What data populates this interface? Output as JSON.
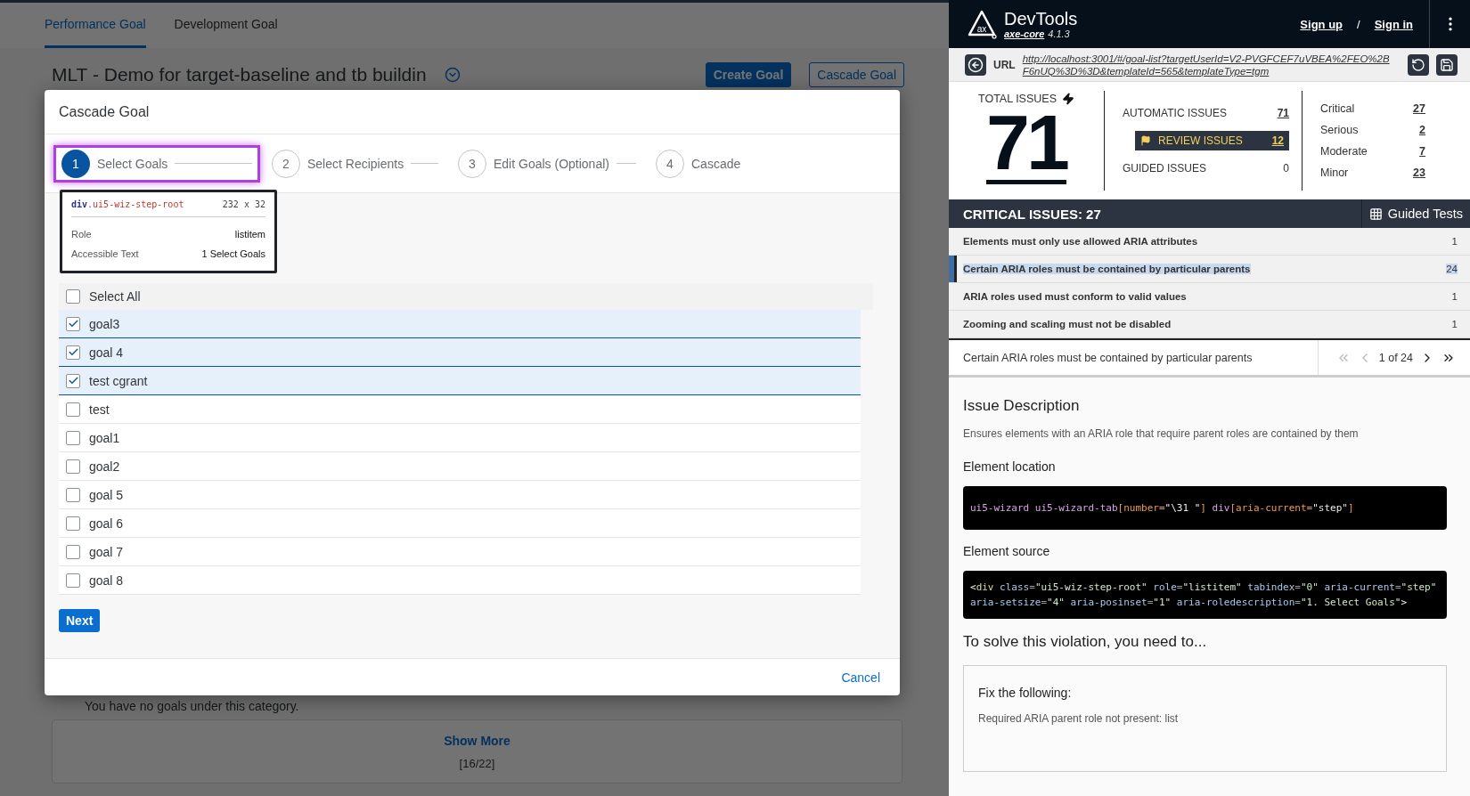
{
  "background_page": {
    "tabs": [
      {
        "label": "Performance Goal",
        "selected": true
      },
      {
        "label": "Development Goal",
        "selected": false
      }
    ],
    "title": "MLT - Demo for target-baseline and tb buildin",
    "buttons": [
      {
        "label": "Create Goal",
        "kind": "primary"
      },
      {
        "label": "Cascade Goal",
        "kind": "secondary"
      }
    ],
    "empty_message": "You have no goals under this category.",
    "show_more": {
      "label": "Show More",
      "count": "[16/22]"
    }
  },
  "dialog": {
    "title": "Cascade Goal",
    "steps": [
      {
        "number": "1",
        "label": "Select Goals",
        "selected": true,
        "highlighted": true
      },
      {
        "number": "2",
        "label": "Select Recipients",
        "selected": false,
        "highlighted": false
      },
      {
        "number": "3",
        "label": "Edit Goals (Optional)",
        "selected": false,
        "highlighted": false
      },
      {
        "number": "4",
        "label": "Cascade",
        "selected": false,
        "highlighted": false
      }
    ],
    "select_all": {
      "label": "Select All",
      "checked": false
    },
    "goals": [
      {
        "label": "goal3",
        "checked": true
      },
      {
        "label": "goal 4",
        "checked": true
      },
      {
        "label": "test cgrant",
        "checked": true
      },
      {
        "label": "test",
        "checked": false
      },
      {
        "label": "goal1",
        "checked": false
      },
      {
        "label": "goal2",
        "checked": false
      },
      {
        "label": "goal 5",
        "checked": false
      },
      {
        "label": "goal 6",
        "checked": false
      },
      {
        "label": "goal 7",
        "checked": false
      },
      {
        "label": "goal 8",
        "checked": false
      }
    ],
    "next_button": "Next",
    "cancel_button": "Cancel",
    "inspector_tooltip": {
      "tag": "div",
      "class_name": ".ui5-wiz-step-root",
      "size": "232 x 32",
      "rows": [
        {
          "label": "Role",
          "value": "listitem"
        },
        {
          "label": "Accessible Text",
          "value": "1 Select Goals"
        }
      ]
    }
  },
  "devtools": {
    "header": {
      "logo_text": "ax",
      "title": "DevTools",
      "engine": "axe-core",
      "version": "4.1.3",
      "links": [
        "Sign up",
        "Sign in"
      ],
      "separator": "/"
    },
    "url_bar": {
      "label": "URL",
      "url": "http://localhost:3001/#/goal-list?targetUserId=V2-PVGFCEF7uVBEA%2FEO%2BF6nUQ%3D%3D&templateId=565&templateType=tgm"
    },
    "total": {
      "label": "TOTAL ISSUES",
      "value": "71"
    },
    "issue_types": [
      {
        "label": "AUTOMATIC ISSUES",
        "count": "71",
        "kind": "link"
      },
      {
        "label": "REVIEW ISSUES",
        "count": "12",
        "kind": "review"
      },
      {
        "label": "GUIDED ISSUES",
        "count": "0",
        "kind": "plain"
      }
    ],
    "severities": [
      {
        "label": "Critical",
        "count": "27"
      },
      {
        "label": "Serious",
        "count": "2"
      },
      {
        "label": "Moderate",
        "count": "7"
      },
      {
        "label": "Minor",
        "count": "23"
      }
    ],
    "issue_list": {
      "title": "CRITICAL ISSUES:",
      "count": "27",
      "guided_tests": "Guided Tests",
      "rows": [
        {
          "label": "Elements must only use allowed ARIA attributes",
          "count": "1",
          "selected": false
        },
        {
          "label": "Certain ARIA roles must be contained by particular parents",
          "count": "24",
          "selected": true
        },
        {
          "label": "ARIA roles used must conform to valid values",
          "count": "1",
          "selected": false
        },
        {
          "label": "Zooming and scaling must not be disabled",
          "count": "1",
          "selected": false
        }
      ]
    },
    "detail": {
      "title": "Certain ARIA roles must be contained by particular parents",
      "position": "1 of 24",
      "pager": [
        {
          "kind": "first",
          "disabled": true
        },
        {
          "kind": "prev",
          "disabled": true
        },
        {
          "kind": "next",
          "disabled": false
        },
        {
          "kind": "last",
          "disabled": false
        }
      ],
      "description": {
        "heading": "Issue Description",
        "text": "Ensures elements with an ARIA role that require parent roles are contained by them"
      },
      "location": {
        "heading": "Element location",
        "code": [
          {
            "kind": "selector",
            "text": "ui5-wizard ui5-wizard-tab"
          },
          {
            "kind": "bracket",
            "text": "[number="
          },
          {
            "kind": "string",
            "text": "\"\\31 \""
          },
          {
            "kind": "bracket",
            "text": "]"
          },
          {
            "kind": "selector",
            "text": " div"
          },
          {
            "kind": "bracket",
            "text": "[aria-current="
          },
          {
            "kind": "string",
            "text": "\"step\""
          },
          {
            "kind": "bracket",
            "text": "]"
          }
        ]
      },
      "source": {
        "heading": "Element source",
        "code": [
          {
            "kind": "punct",
            "text": "<"
          },
          {
            "kind": "tag",
            "text": "div"
          },
          {
            "kind": "attr",
            "text": " class"
          },
          {
            "kind": "op",
            "text": "="
          },
          {
            "kind": "value",
            "text": "\"ui5-wiz-step-root\""
          },
          {
            "kind": "attr",
            "text": " role"
          },
          {
            "kind": "op",
            "text": "="
          },
          {
            "kind": "value",
            "text": "\"listitem\""
          },
          {
            "kind": "attr",
            "text": " tabindex"
          },
          {
            "kind": "op",
            "text": "="
          },
          {
            "kind": "value",
            "text": "\"0\""
          },
          {
            "kind": "attr",
            "text": " aria-current"
          },
          {
            "kind": "op",
            "text": "="
          },
          {
            "kind": "value",
            "text": "\"step\""
          },
          {
            "kind": "attr",
            "text": " aria-setsize"
          },
          {
            "kind": "op",
            "text": "="
          },
          {
            "kind": "value",
            "text": "\"4\""
          },
          {
            "kind": "attr",
            "text": " aria-posinset"
          },
          {
            "kind": "op",
            "text": "="
          },
          {
            "kind": "value",
            "text": "\"1\""
          },
          {
            "kind": "attr",
            "text": " aria-roledescription"
          },
          {
            "kind": "op",
            "text": "="
          },
          {
            "kind": "value",
            "text": "\"1. Select Goals\""
          },
          {
            "kind": "punct",
            "text": ">"
          }
        ]
      },
      "solution": {
        "heading": "To solve this violation, you need to...",
        "box_title": "Fix the following:",
        "items": [
          "Required ARIA parent role not present: list"
        ]
      }
    }
  }
}
